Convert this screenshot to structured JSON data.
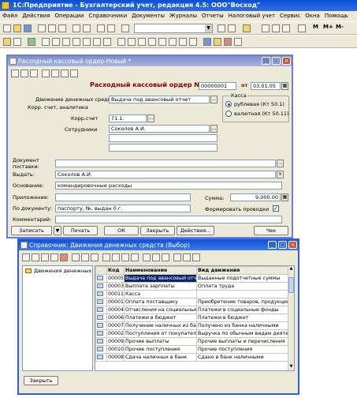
{
  "app": {
    "title": "1С:Предприятие - Бухгалтерский учет, редакция 4.5: ООО\"Восход\""
  },
  "menu": [
    "Файл",
    "Действия",
    "Операции",
    "Справочники",
    "Документы",
    "Журналы",
    "Отчеты",
    "Налоговый учет",
    "Сервис",
    "Окна",
    "Помощь"
  ],
  "toolbar": {
    "m_label": "М",
    "mplus_label": "М+",
    "mminus_label": "М-"
  },
  "doc": {
    "window_title": "Расходный кассовый ордер-Новый *",
    "heading": "Расходный кассовый ордер №",
    "number": "00000001",
    "from_label": "от",
    "date": "03.01.05",
    "movement_label": "Движение денежных средств",
    "movement_value": "Выдача под авансовый отчет",
    "corr_label": "Корр. счет, аналитика",
    "corr_account_label": "Корр.счет",
    "corr_account_value": "71.1.",
    "employees_label": "Сотрудники",
    "employee_value": "Соколов А.И.",
    "cash_group_label": "Касса",
    "radio_ruble": "рублевая (Кт 50.1)",
    "radio_currency": "валютная (Кт 50.11)",
    "basis_doc_label1": "Документ",
    "basis_doc_label2": "поставки:",
    "issue_label": "Выдать:",
    "issue_value": "Соколов А.И.",
    "reason_label": "Основание:",
    "reason_value": "командировочные расходы",
    "attachment_label": "Приложение:",
    "sum_label": "Сумма:",
    "sum_value": "9,000.00",
    "bydoc_label": "По документу:",
    "bydoc_value": "паспорту, №, выдан  0 г.",
    "postings_label": "Формировать проводки",
    "comment_label": "Комментарий:",
    "buttons": {
      "record": "Записать",
      "print": "Печать",
      "ok": "ОК",
      "close": "Закрыть",
      "actions": "Действия...",
      "check": "Чек"
    }
  },
  "ref": {
    "window_title": "Справочник: Движения денежных средств (Выбор)",
    "tree_item": "Движения денежных",
    "columns": [
      "Код",
      "Наименование",
      "Вид движения"
    ],
    "rows": [
      {
        "code": "00005",
        "name": "Выдача под авансовый отчет",
        "kind": "Выданные подотчетные суммы"
      },
      {
        "code": "00003",
        "name": "Выплата зарплаты",
        "kind": "Оплата труда"
      },
      {
        "code": "00011",
        "name": "Касса",
        "kind": ""
      },
      {
        "code": "00001",
        "name": "Оплата поставщику",
        "kind": "Приобретение товаров, продукции,"
      },
      {
        "code": "00004",
        "name": "Отчисления на социальные н",
        "kind": "Платежи в социальные фонды"
      },
      {
        "code": "00006",
        "name": "Платежи в бюджет",
        "kind": "Платежи в бюджет"
      },
      {
        "code": "00007",
        "name": "Получение наличных из банк",
        "kind": "Получено из банка наличными"
      },
      {
        "code": "00002",
        "name": "Поступления от покупателей",
        "kind": "Выручка по обычным видам деятел"
      },
      {
        "code": "00009",
        "name": "Прочие выплаты",
        "kind": "Прочие выплаты и перечисления"
      },
      {
        "code": "00010",
        "name": "Прочие поступления",
        "kind": "Прочие поступления"
      },
      {
        "code": "00008",
        "name": "Сдача наличных в банк",
        "kind": "Сдано в банк наличными"
      }
    ],
    "close_button": "Закрыть"
  }
}
